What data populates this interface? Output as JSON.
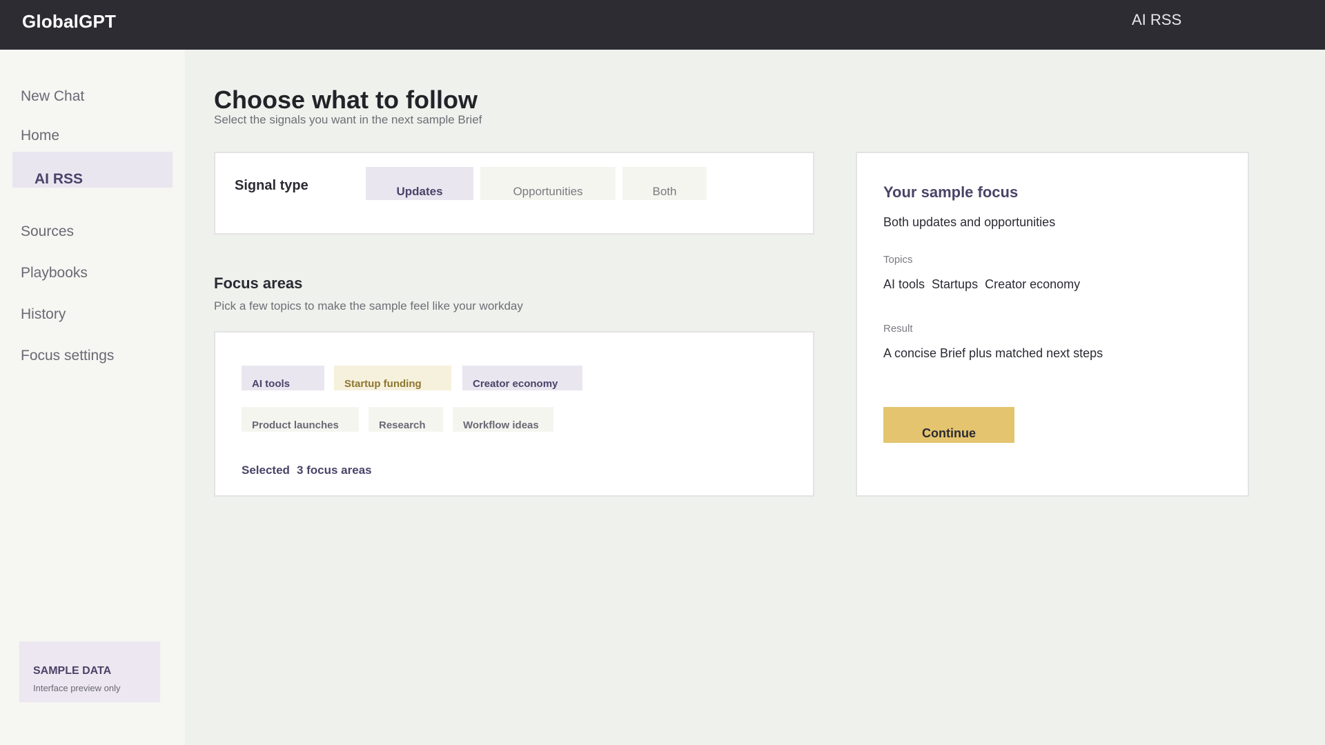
{
  "app": {
    "brand": "GlobalGPT",
    "top_right": "AI RSS"
  },
  "sidebar": {
    "items": [
      {
        "label": "New Chat"
      },
      {
        "label": "Home"
      },
      {
        "label": "AI RSS",
        "active": true
      },
      {
        "label": "Sources"
      },
      {
        "label": "Playbooks"
      },
      {
        "label": "History"
      },
      {
        "label": "Focus settings"
      }
    ],
    "sample": {
      "title": "SAMPLE DATA",
      "subtitle": "Interface preview only"
    }
  },
  "main": {
    "title": "Choose what to follow",
    "subtitle": "Select the signals you want in the next sample Brief",
    "signal": {
      "label": "Signal type",
      "options": [
        "Updates",
        "Opportunities",
        "Both"
      ],
      "selected": "Updates"
    },
    "focus": {
      "title": "Focus areas",
      "subtitle": "Pick a few topics to make the sample feel like your workday",
      "chips": [
        {
          "label": "AI tools",
          "state": "selected"
        },
        {
          "label": "Startup funding",
          "state": "highlight"
        },
        {
          "label": "Creator economy",
          "state": "selected"
        },
        {
          "label": "Product launches",
          "state": "default"
        },
        {
          "label": "Research",
          "state": "default"
        },
        {
          "label": "Workflow ideas",
          "state": "default"
        }
      ],
      "selected_label": "Selected",
      "selected_count": "3 focus areas"
    }
  },
  "summary": {
    "title": "Your sample focus",
    "focus_text": "Both updates and opportunities",
    "topics_label": "Topics",
    "topics": [
      "AI tools",
      "Startups",
      "Creator economy"
    ],
    "result_label": "Result",
    "result_text": "A concise Brief plus matched next steps",
    "continue_label": "Continue"
  },
  "colors": {
    "topbar": "#2e2c33",
    "accent_purple": "#4a4368",
    "chip_purple": "#e9e6f0",
    "chip_yellow": "#f6f1dc",
    "button_yellow": "#e4c46e",
    "page_bg": "#eef1ec"
  }
}
